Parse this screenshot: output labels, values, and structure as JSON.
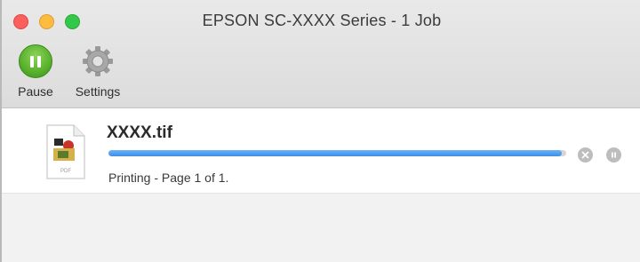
{
  "window": {
    "title": "EPSON SC-XXXX Series - 1 Job"
  },
  "toolbar": {
    "pause_label": "Pause",
    "settings_label": "Settings"
  },
  "job": {
    "filename": "XXXX.tif",
    "status": "Printing - Page 1 of 1.",
    "progress": 0.99,
    "icon_label": "PDF"
  },
  "colors": {
    "pause_button": "#58b02b",
    "progress_fill": "#3b8ee9",
    "close": "#fc605c",
    "minimize": "#fdbc40",
    "maximize": "#34c84a"
  }
}
